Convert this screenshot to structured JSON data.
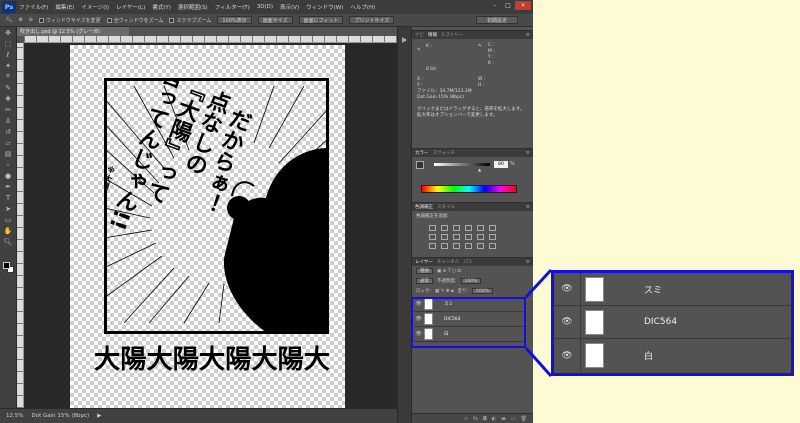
{
  "app": {
    "logo": "Ps",
    "menu": [
      "ファイル(F)",
      "編集(E)",
      "イメージ(I)",
      "レイヤー(L)",
      "書式(Y)",
      "選択範囲(S)",
      "フィルター(T)",
      "3D(D)",
      "表示(V)",
      "ウィンドウ(W)",
      "ヘルプ(H)"
    ],
    "window_controls": [
      "–",
      "□",
      "✕"
    ]
  },
  "options_bar": {
    "fit_windows_label": "ウィンドウサイズを変更",
    "all_windows_label": "全ウィンドウをズーム",
    "scrubby_zoom_label": "スクラブズーム",
    "actual_pixels_label": "100%表示",
    "fit_screen_label": "画面サイズ",
    "fill_screen_label": "画面にフィット",
    "print_size_label": "プリントサイズ",
    "workspace_label": "初期設定"
  },
  "document": {
    "tab_title": "吹き出し.psd @ 12.5% (グレー/8)",
    "zoom": "12.5%",
    "doc_profile": "Dot Gain 15% (8bpc)"
  },
  "artwork": {
    "speech_lines": [
      "だからぁ！",
      "点なしの",
      "『大陽』って",
      "言ってんじゃん!!"
    ],
    "small_note": "※大陽ではありません",
    "bottom_banner": "大陽大陽大陽大陽大"
  },
  "panels": {
    "info": {
      "tabs": [
        "ナビ",
        "情報",
        "ヒストリー"
      ],
      "active_tab": "情報",
      "file_line": "ファイル：34.7M/123.1M",
      "profile_line": "Dot Gain 15% (8bpc)",
      "hint_line": "クリックまたはドラッグすると、倍率を拡大します。拡大率はオプションバーで変更します。"
    },
    "color": {
      "tabs": [
        "カラー",
        "スウォッチ"
      ],
      "channel_value": "80",
      "unit": "%"
    },
    "adjustments": {
      "tabs": [
        "色調補正",
        "スタイル"
      ],
      "heading": "色調補正を追加"
    },
    "layers": {
      "tabs": [
        "レイヤー",
        "チャンネル",
        "パス"
      ],
      "kind_label": "種類",
      "blend_mode": "通常",
      "opacity_label": "不透明度:",
      "opacity_value": "100%",
      "lock_label": "ロック:",
      "fill_label": "塗り:",
      "fill_value": "100%",
      "items": [
        {
          "name": "スミ"
        },
        {
          "name": "DIC564"
        },
        {
          "name": "白"
        }
      ]
    }
  },
  "colors": {
    "highlight": "#1010e0",
    "page_bg": "#fdfbd3"
  }
}
